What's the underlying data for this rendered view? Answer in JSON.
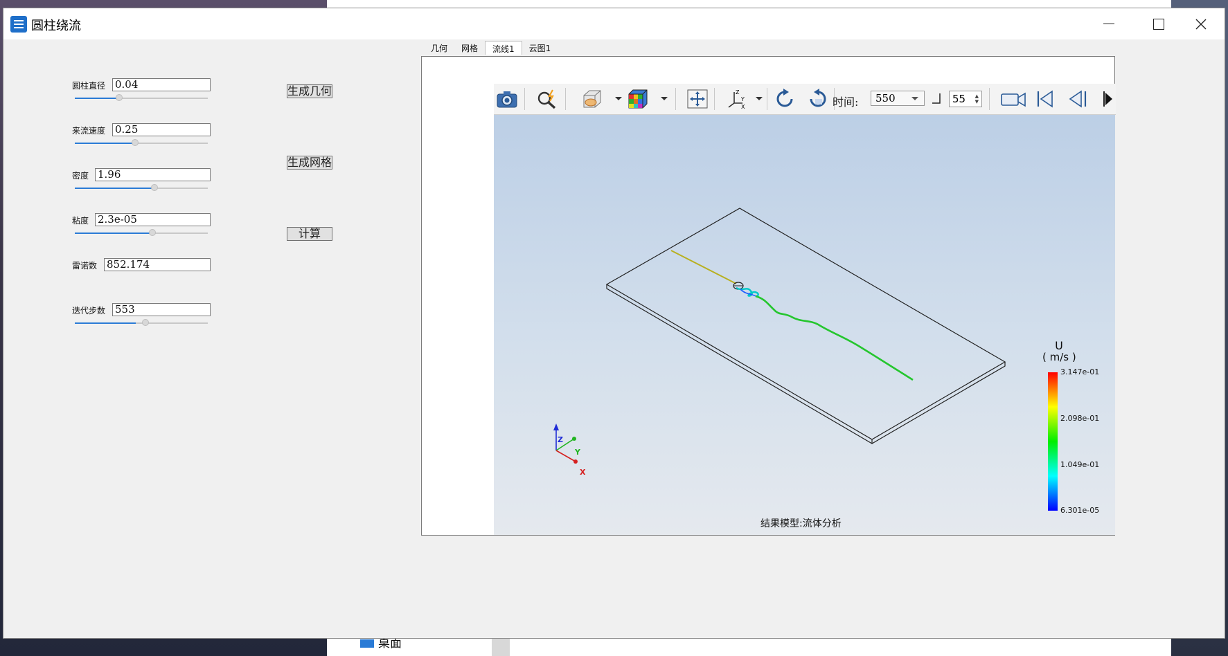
{
  "window": {
    "title": "圆柱绕流"
  },
  "params": [
    {
      "label": "圆柱直径",
      "value": "0.04",
      "slider": 0.33
    },
    {
      "label": "来流速度",
      "value": "0.25",
      "slider": 0.45
    },
    {
      "label": "密度",
      "value": "1.96",
      "slider": 0.6
    },
    {
      "label": "粘度",
      "value": "2.3e-05",
      "slider": 0.58
    },
    {
      "label": "雷诺数",
      "value": "852.174"
    },
    {
      "label": "迭代步数",
      "value": "553",
      "slider": 0.52
    }
  ],
  "buttons": {
    "gen_geometry": "生成几何",
    "gen_mesh": "生成网格",
    "compute": "计算"
  },
  "tabs": [
    "几何",
    "网格",
    "流线1",
    "云图1"
  ],
  "active_tab": "流线1",
  "toolbar": {
    "time_label": "时间:",
    "time_value": "550",
    "step_value": "55",
    "icons": [
      "camera-icon",
      "zoom-lightning-icon",
      "section-view-icon",
      "color-cube-icon",
      "fit-view-icon",
      "axes-icon",
      "rotate-cw-icon",
      "rotate-ccw-icon",
      "video-camera-icon",
      "first-frame-icon",
      "prev-frame-icon",
      "next-frame-icon"
    ]
  },
  "legend": {
    "title": "U",
    "unit": "( m/s )",
    "ticks": [
      "3.147e-01",
      "2.098e-01",
      "1.049e-01",
      "6.301e-05"
    ],
    "colors": [
      "#ff0000",
      "#ffff00",
      "#00ee00",
      "#00ffff",
      "#0000ff"
    ]
  },
  "triad": {
    "x": "X",
    "y": "Y",
    "z": "Z"
  },
  "result_label": "结果模型:流体分析",
  "taskbar": {
    "item": "桌面"
  }
}
